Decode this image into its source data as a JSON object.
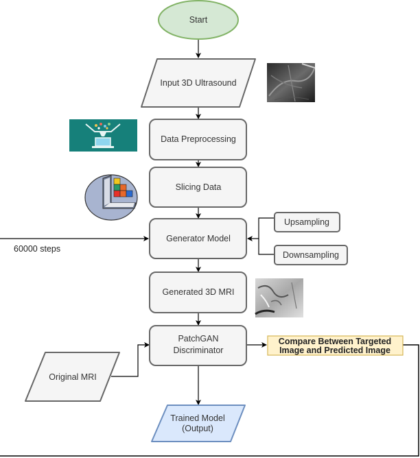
{
  "diagram": {
    "type": "flowchart",
    "nodes": {
      "start": {
        "label": "Start",
        "shape": "ellipse",
        "fill": "#d5e8d4",
        "stroke": "#82b366"
      },
      "input": {
        "label": "Input 3D Ultrasound",
        "shape": "parallelogram",
        "fill": "#f5f5f5",
        "stroke": "#666666"
      },
      "preprocess": {
        "label": "Data Preprocessing",
        "shape": "rounded-rect",
        "fill": "#f5f5f5",
        "stroke": "#666666"
      },
      "slicing": {
        "label": "Slicing Data",
        "shape": "rounded-rect",
        "fill": "#f5f5f5",
        "stroke": "#666666"
      },
      "generator": {
        "label": "Generator Model",
        "shape": "rounded-rect",
        "fill": "#f5f5f5",
        "stroke": "#666666"
      },
      "upsampling": {
        "label": "Upsampling",
        "shape": "rounded-rect",
        "fill": "#f5f5f5",
        "stroke": "#666666"
      },
      "downsampling": {
        "label": "Downsampling",
        "shape": "rounded-rect",
        "fill": "#f5f5f5",
        "stroke": "#666666"
      },
      "generated": {
        "label": "Generated 3D MRI",
        "shape": "rounded-rect",
        "fill": "#f5f5f5",
        "stroke": "#666666"
      },
      "discriminator": {
        "line1": "PatchGAN",
        "line2": "Discriminator",
        "shape": "rounded-rect",
        "fill": "#f5f5f5",
        "stroke": "#666666"
      },
      "compare": {
        "line1": "Compare Between Targeted",
        "line2": "Image and Predicted Image",
        "shape": "rect",
        "fill": "#fff2cc",
        "stroke": "#d6b656"
      },
      "original": {
        "label": "Original MRI",
        "shape": "parallelogram",
        "fill": "#f5f5f5",
        "stroke": "#666666"
      },
      "output": {
        "line1": "Trained Model",
        "line2": "(Output)",
        "shape": "parallelogram",
        "fill": "#dae8fc",
        "stroke": "#6c8ebf"
      }
    },
    "edge_labels": {
      "feedback_steps": "60000 steps"
    },
    "images": {
      "ultrasound": "ultrasound-scan-thumbnail",
      "preprocessing": "data-funnel-laptop-icon",
      "slicing": "sliced-sphere-cubes-icon",
      "mri": "mri-scan-thumbnail"
    },
    "colors": {
      "edge": "#000000",
      "preprocess_icon_bg": "#16807a"
    }
  }
}
